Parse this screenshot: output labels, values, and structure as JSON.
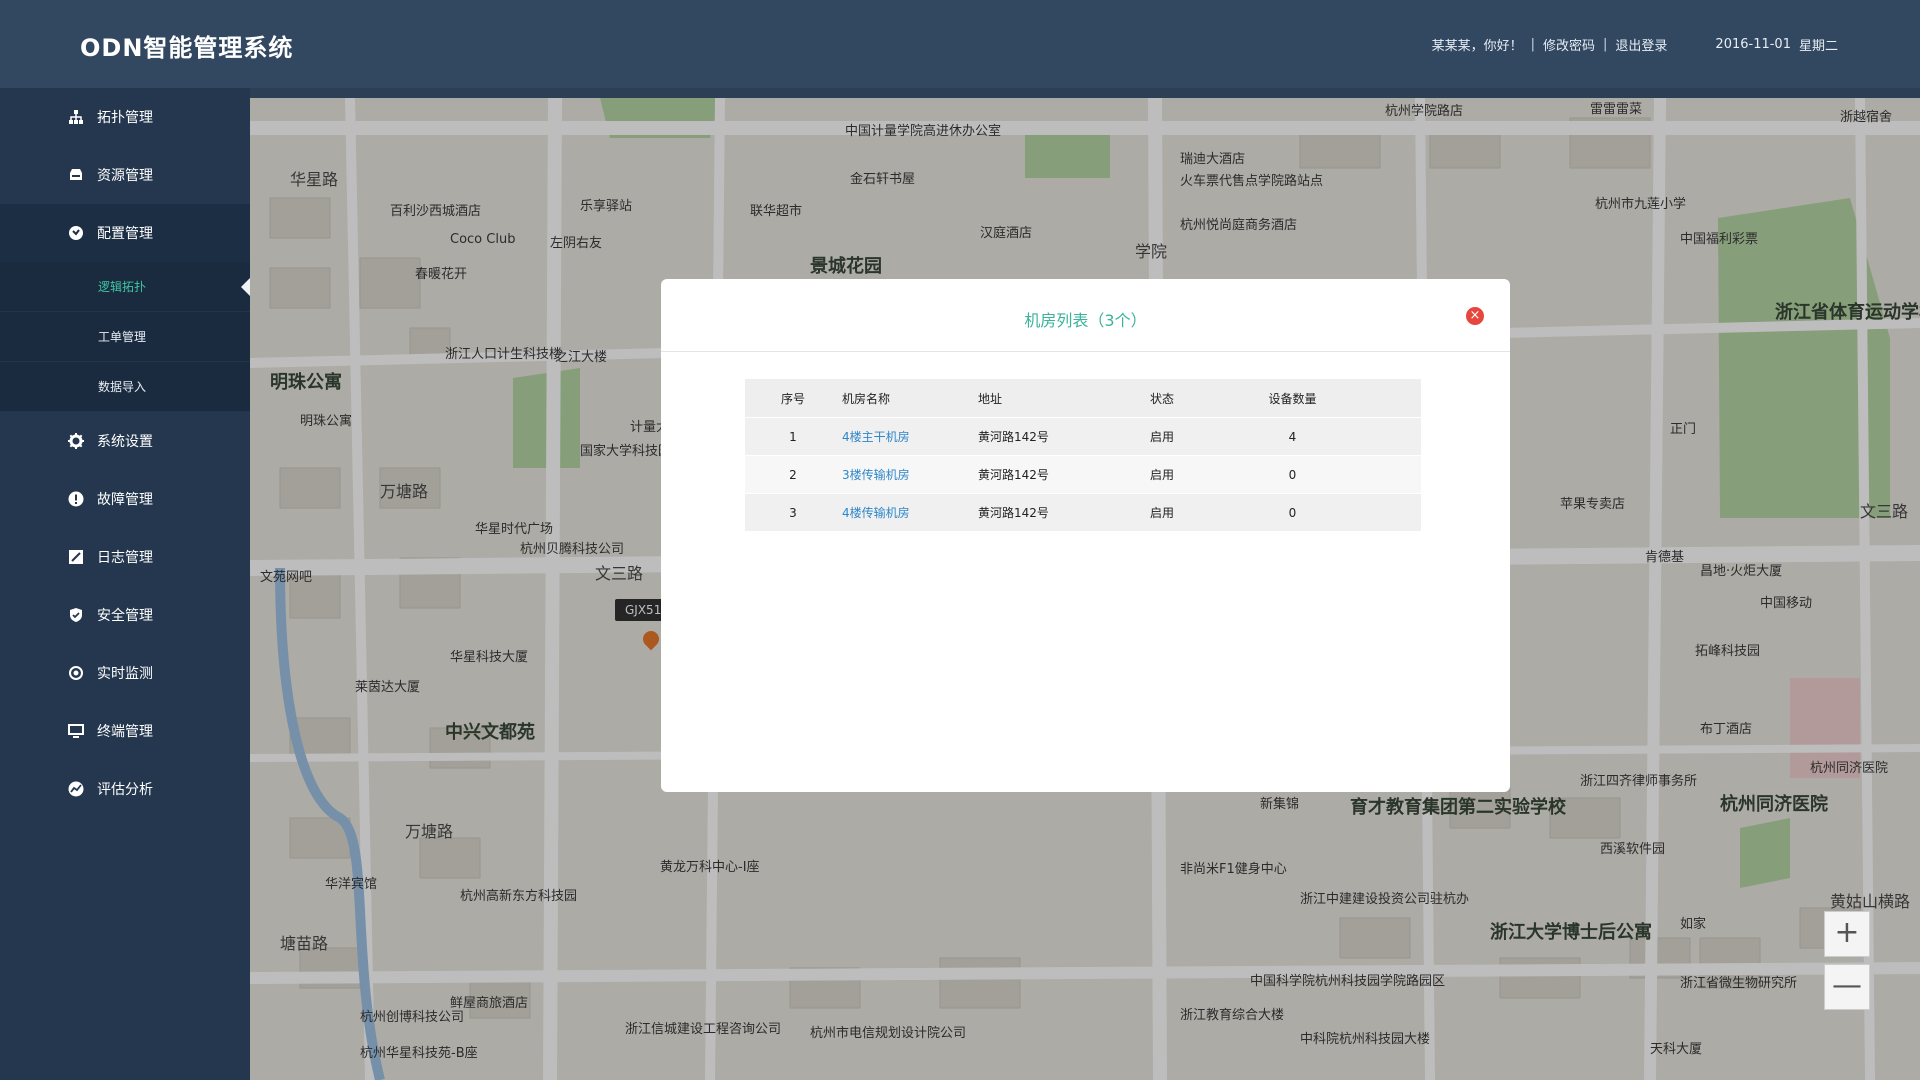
{
  "header": {
    "title": "ODN智能管理系统",
    "greeting": "某某某，你好！",
    "change_password": "修改密码",
    "logout": "退出登录",
    "separator": "|",
    "date": "2016-11-01",
    "weekday": "星期二"
  },
  "sidebar": {
    "items": [
      {
        "label": "拓扑管理",
        "icon": "topology-icon"
      },
      {
        "label": "资源管理",
        "icon": "resource-icon"
      },
      {
        "label": "配置管理",
        "icon": "config-icon"
      },
      {
        "label": "系统设置",
        "icon": "gear-icon"
      },
      {
        "label": "故障管理",
        "icon": "alert-icon"
      },
      {
        "label": "日志管理",
        "icon": "log-icon"
      },
      {
        "label": "安全管理",
        "icon": "shield-icon"
      },
      {
        "label": "实时监测",
        "icon": "monitor-target-icon"
      },
      {
        "label": "终端管理",
        "icon": "computer-icon"
      },
      {
        "label": "评估分析",
        "icon": "analysis-icon"
      }
    ],
    "sub_items": [
      {
        "label": "逻辑拓扑"
      },
      {
        "label": "工单管理"
      },
      {
        "label": "数据导入"
      }
    ]
  },
  "map": {
    "labels": [
      "华星路",
      "百利沙西城酒店",
      "乐享驿站",
      "Coco Club",
      "左阴右友",
      "春暖花开",
      "联华超市",
      "金石轩书屋",
      "中国计量学院高进休办公室",
      "汉庭酒店",
      "景城花园",
      "明珠公寓",
      "明珠公寓",
      "浙江人口计生科技楼",
      "之江大楼",
      "万塘路",
      "华星时代广场",
      "杭州贝腾科技公司",
      "文苑网吧",
      "文三路",
      "华星科技大厦",
      "莱茵达大厦",
      "中兴文都苑",
      "万塘路",
      "华洋宾馆",
      "杭州高新东方科技园",
      "黄龙万科中心-I座",
      "塘苗路",
      "鲜屋商旅酒店",
      "杭州创博科技公司",
      "杭州华星科技苑-B座",
      "浙江信城建设工程咨询公司",
      "杭州市电信规划设计院公司",
      "浙江省体育运动学校",
      "杭州市九莲小学",
      "中国福利彩票",
      "苹果专卖店",
      "文三路",
      "肯德基",
      "昌地·火炬大厦",
      "中国移动",
      "拓峰科技园",
      "布丁酒店",
      "杭州同济医院",
      "杭州同济医院",
      "育才教育集团第二实验学校",
      "浙江四齐律师事务所",
      "西溪软件园",
      "新集锦",
      "浙江中建建设投资公司驻杭办",
      "非尚米F1健身中心",
      "浙江大学博士后公寓",
      "如家",
      "浙江省微生物研究所",
      "黄姑山横路",
      "中国科学院杭州科技园学院路园区",
      "浙江教育综合大楼",
      "中科院杭州科技园大楼",
      "天科大厦",
      "瑞迪大酒店",
      "火车票代售点学院路站点",
      "杭州悦尚庭商务酒店",
      "杭州学院路店",
      "雷雷雷菜",
      "浙越宿舍",
      "学院",
      "正门",
      "国家大学科技园",
      "计量大"
    ],
    "marker_tag": "GJX51",
    "zoom_in": "+",
    "zoom_out": "—"
  },
  "modal": {
    "title": "机房列表（3个）",
    "close_label": "×",
    "columns": [
      "序号",
      "机房名称",
      "地址",
      "状态",
      "设备数量"
    ],
    "rows": [
      {
        "idx": "1",
        "name": "4楼主干机房",
        "addr": "黄河路142号",
        "status": "启用",
        "count": "4"
      },
      {
        "idx": "2",
        "name": "3楼传输机房",
        "addr": "黄河路142号",
        "status": "启用",
        "count": "0"
      },
      {
        "idx": "3",
        "name": "4楼传输机房",
        "addr": "黄河路142号",
        "status": "启用",
        "count": "0"
      }
    ]
  },
  "colors": {
    "header_bg": "#324760",
    "sidebar_bg": "#24374e",
    "accent": "#3fc5a5",
    "link": "#2f86c8",
    "close": "#e5473f"
  }
}
